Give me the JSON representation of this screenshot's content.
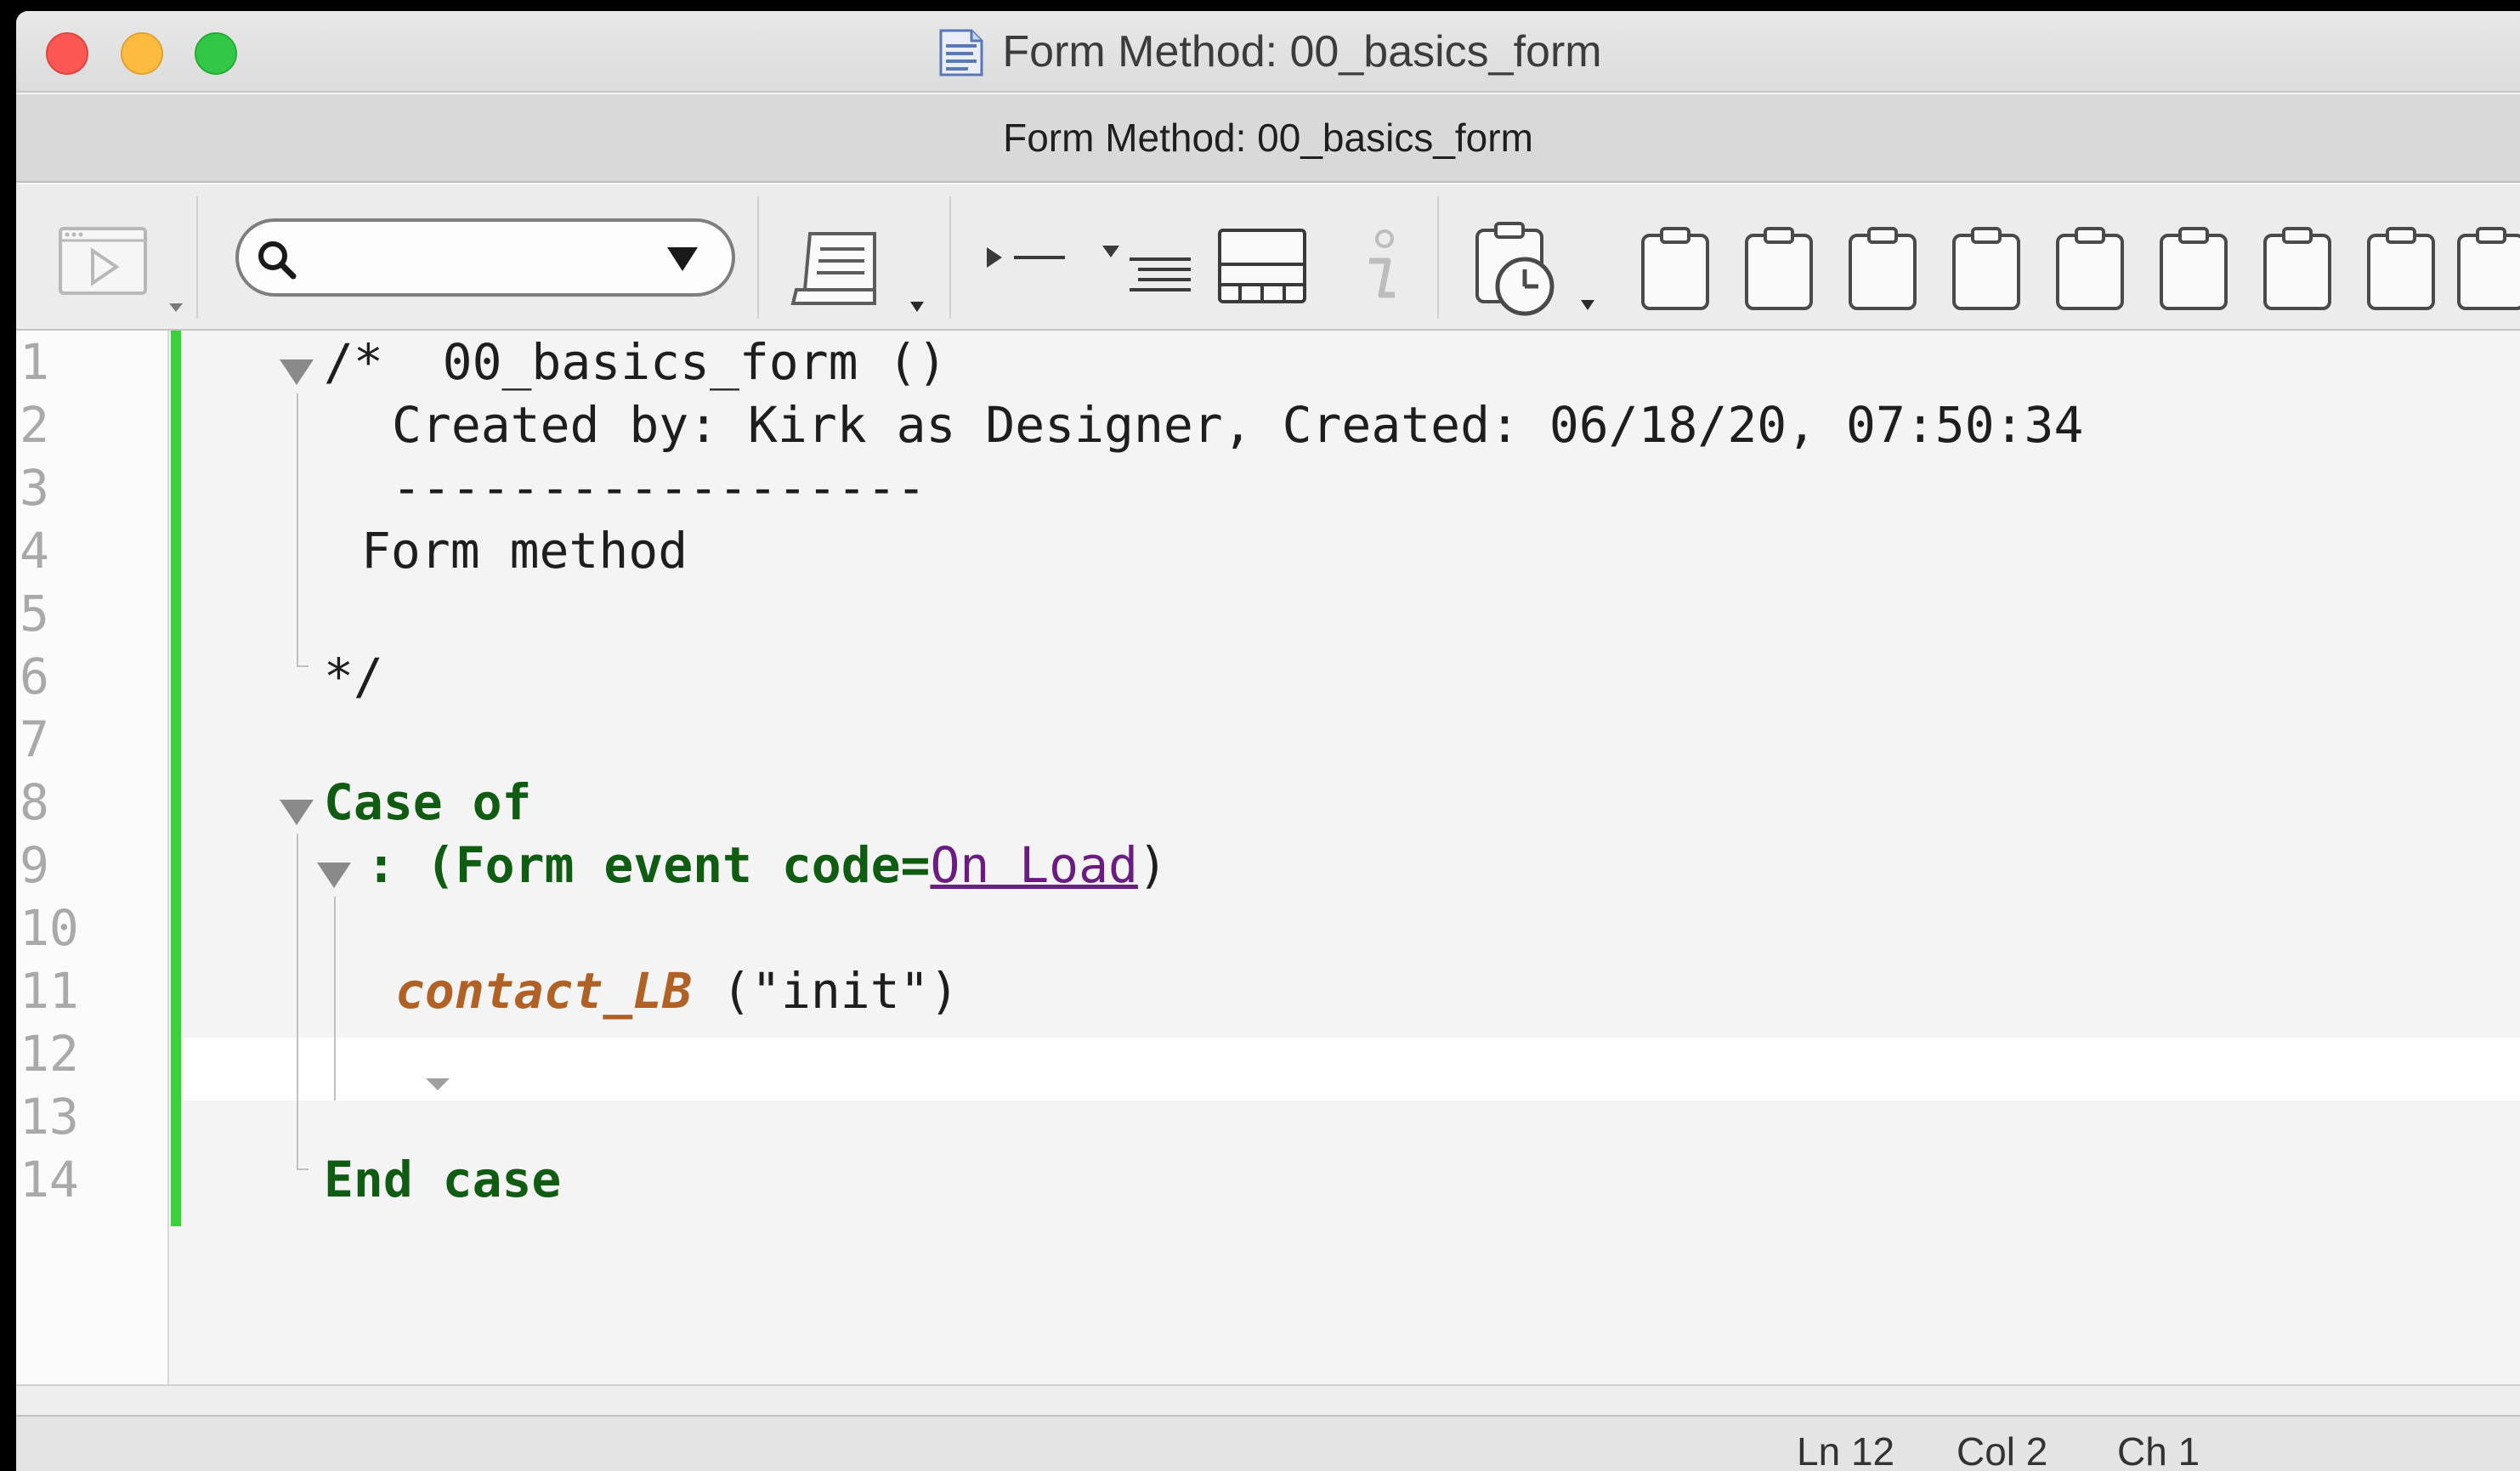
{
  "window": {
    "title": "Form Method: 00_basics_form",
    "tab_title": "Form Method: 00_basics_form"
  },
  "toolbar": {
    "search": {
      "value": "",
      "placeholder": ""
    },
    "icons": [
      "run-method-icon",
      "search-icon",
      "method-properties-icon",
      "breakpoint-icon",
      "indent-icon",
      "macro-icon",
      "info-icon",
      "history-icon",
      "clipboard-1-icon",
      "clipboard-2-icon",
      "clipboard-3-icon",
      "clipboard-4-icon",
      "clipboard-5-icon",
      "clipboard-6-icon",
      "clipboard-7-icon",
      "clipboard-8-icon",
      "clipboard-9-icon"
    ]
  },
  "editor": {
    "line_numbers": [
      "1",
      "2",
      "3",
      "4",
      "5",
      "6",
      "7",
      "8",
      "9",
      "10",
      "11",
      "12",
      "13",
      "14"
    ],
    "lines": {
      "l1": "/*  00_basics_form ()",
      "l2": "Created by: Kirk as Designer, Created: 06/18/20, 07:50:34",
      "l3": "------------------",
      "l4": "Form method",
      "l6": "*/",
      "l8": "Case of",
      "l9_prefix": ": (Form event code=",
      "l9_const": "On Load",
      "l9_suffix": ")",
      "l11_fn": "contact_LB",
      "l11_args": " (\"init\")",
      "l13": "End case"
    },
    "current_line": 12
  },
  "status": {
    "line": "Ln 12",
    "column": "Col 2",
    "char": "Ch 1"
  },
  "colors": {
    "keyword": "#0f5c12",
    "function": "#b06226",
    "constant": "#6a1c82",
    "change_bar": "#3ad13a"
  }
}
